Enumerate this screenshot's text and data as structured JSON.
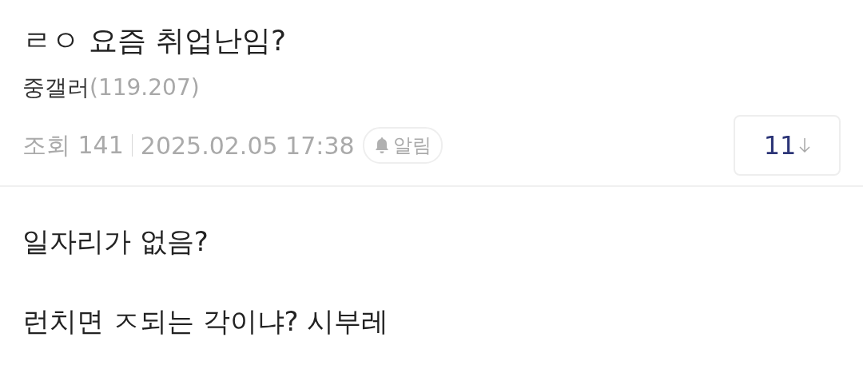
{
  "post": {
    "title": "ㄹㅇ 요즘 취업난임?",
    "author": "중갤러",
    "author_ip": "(119.207)",
    "views_label": "조회 141",
    "date": "2025.02.05 17:38",
    "alert_label": "알림",
    "comment_count": "11"
  },
  "body": [
    "일자리가 없음?",
    "런치면 ㅈ되는 각이냐? 시부레"
  ]
}
